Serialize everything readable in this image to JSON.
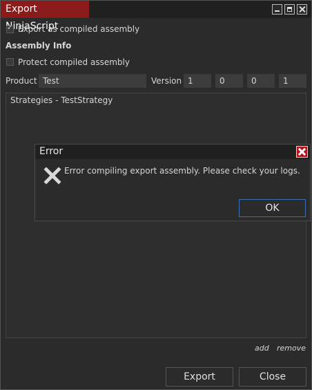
{
  "window": {
    "title": "Export NinjaScript"
  },
  "options": {
    "export_compiled_label": "Export as compiled assembly",
    "export_compiled_checked": true,
    "assembly_info_heading": "Assembly Info",
    "protect_label": "Protect compiled assembly",
    "protect_checked": false
  },
  "product": {
    "label": "Product",
    "value": "Test"
  },
  "version": {
    "label": "Version",
    "parts": [
      "1",
      "0",
      "0",
      "1"
    ]
  },
  "list": {
    "items": [
      "Strategies - TestStrategy"
    ]
  },
  "links": {
    "add": "add",
    "remove": "remove"
  },
  "buttons": {
    "export": "Export",
    "close": "Close"
  },
  "error_dialog": {
    "title": "Error",
    "message": "Error compiling export assembly. Please check your logs.",
    "ok": "OK"
  }
}
